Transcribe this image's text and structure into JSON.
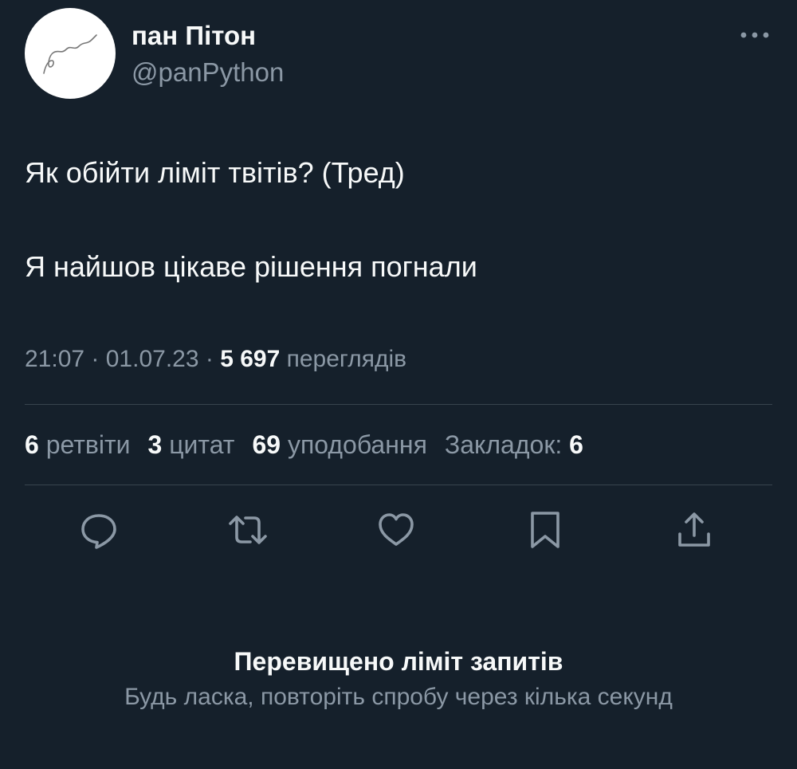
{
  "author": {
    "display_name": "пан Пітон",
    "handle": "@panPython",
    "avatar_icon": "squiggle-line-avatar"
  },
  "header": {
    "more_icon": "more-horizontal-icon"
  },
  "tweet": {
    "lines": [
      "Як обійти ліміт твітів? (Тред)",
      "Я найшов цікаве рішення погнали"
    ]
  },
  "meta": {
    "time": "21:07",
    "separator": " · ",
    "date": "01.07.23",
    "views_count": "5 697",
    "views_label": "переглядів"
  },
  "stats": {
    "retweets": {
      "count": "6",
      "label": "ретвіти"
    },
    "quotes": {
      "count": "3",
      "label": "цитат"
    },
    "likes": {
      "count": "69",
      "label": "уподобання"
    },
    "bookmarks": {
      "label": "Закладок:",
      "count": "6"
    }
  },
  "actions": [
    "reply-icon",
    "retweet-icon",
    "like-icon",
    "bookmark-icon",
    "share-icon"
  ],
  "error": {
    "title": "Перевищено ліміт запитів",
    "subtitle": "Будь ласка, повторіть спробу через кілька секунд"
  },
  "colors": {
    "background": "#15202b",
    "primary_text": "#f7f9f9",
    "secondary_text": "#8b98a5",
    "divider": "#38444d"
  }
}
